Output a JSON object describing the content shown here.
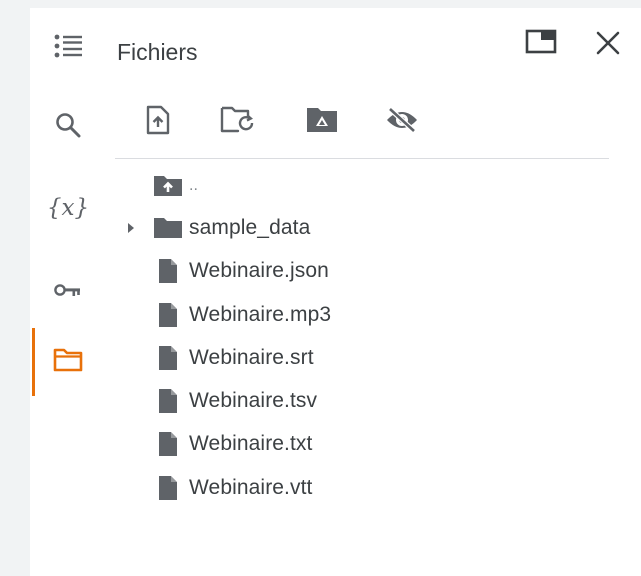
{
  "panel": {
    "title": "Fichiers",
    "accent_color": "#e8710a"
  },
  "rail": {
    "items": [
      {
        "icon": "toc-icon"
      },
      {
        "icon": "search-icon"
      },
      {
        "icon": "variables-icon",
        "glyph": "{x}"
      },
      {
        "icon": "key-icon"
      },
      {
        "icon": "folder-icon",
        "active": true
      }
    ]
  },
  "window": {
    "expand_icon": "open-in-tab-icon",
    "close_icon": "close-icon"
  },
  "toolbar": [
    {
      "icon": "upload-file-icon"
    },
    {
      "icon": "refresh-folder-icon"
    },
    {
      "icon": "mount-drive-icon"
    },
    {
      "icon": "hide-files-icon"
    }
  ],
  "files": {
    "parent": "..",
    "items": [
      {
        "name": "sample_data",
        "type": "folder"
      },
      {
        "name": "Webinaire.json",
        "type": "file"
      },
      {
        "name": "Webinaire.mp3",
        "type": "file"
      },
      {
        "name": "Webinaire.srt",
        "type": "file"
      },
      {
        "name": "Webinaire.tsv",
        "type": "file"
      },
      {
        "name": "Webinaire.txt",
        "type": "file"
      },
      {
        "name": "Webinaire.vtt",
        "type": "file"
      }
    ]
  }
}
